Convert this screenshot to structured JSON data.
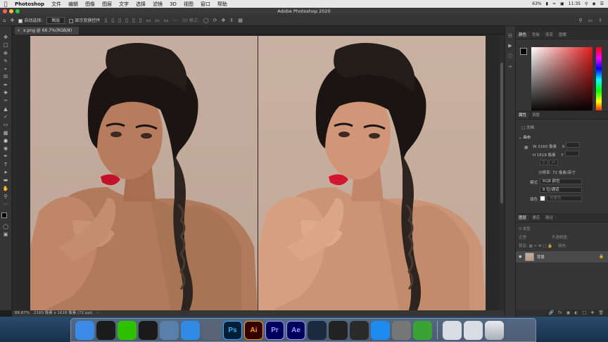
{
  "menubar": {
    "app": "Photoshop",
    "items": [
      "文件",
      "编辑",
      "图像",
      "图层",
      "文字",
      "选择",
      "滤镜",
      "3D",
      "视图",
      "窗口",
      "帮助"
    ],
    "battery": "63%",
    "clock": "11:35"
  },
  "window": {
    "title": "Adobe Photoshop 2020"
  },
  "options": {
    "auto_select_label": "自动选择:",
    "auto_select_value": "图层",
    "show_transform_label": "显示变换控件",
    "mode_3d_label": "3D 模式:"
  },
  "document": {
    "tab_label": "x.png @ 66.7%(RGB/8)",
    "zoom": "66.67%",
    "size_info": "2160 像素 x 1618 像素 (72 ppi)"
  },
  "color_panel": {
    "tabs": [
      "颜色",
      "色板",
      "渐变",
      "图案"
    ]
  },
  "properties_panel": {
    "tabs": [
      "属性",
      "调整"
    ],
    "doc_label": "文档",
    "canvas_section": "画布",
    "w_label": "W",
    "w_value": "2160 像素",
    "h_label": "H",
    "h_value": "1618 像素",
    "x_label": "X",
    "y_label": "Y",
    "resolution": "分辨率: 72 像素/英寸",
    "mode_label": "模式",
    "mode_value": "RGB 颜色",
    "depth_value": "8 位/通道",
    "fill_label": "填色",
    "fill_value": "背景色"
  },
  "layers_panel": {
    "tabs": [
      "图层",
      "通道",
      "路径"
    ],
    "kind_label": "类型",
    "blend_mode": "正常",
    "opacity_label": "不透明度:",
    "lock_label": "锁定:",
    "fill_label": "填充:",
    "layer_name": "背景"
  },
  "dock": {
    "apps": [
      {
        "name": "finder",
        "label": "",
        "color": "#3b8ce8"
      },
      {
        "name": "qq",
        "label": "",
        "color": "#1b1b1b"
      },
      {
        "name": "wechat",
        "label": "",
        "color": "#2dc100"
      },
      {
        "name": "music",
        "label": "",
        "color": "#1a1a1a"
      },
      {
        "name": "preview",
        "label": "",
        "color": "#5a7fa8"
      },
      {
        "name": "safari",
        "label": "",
        "color": "#2f8be3"
      },
      {
        "name": "launchpad",
        "label": "",
        "color": "#596574"
      },
      {
        "name": "photoshop",
        "label": "Ps",
        "color": "#001e36",
        "fg": "#31a8ff"
      },
      {
        "name": "illustrator",
        "label": "Ai",
        "color": "#330000",
        "fg": "#ff9a00"
      },
      {
        "name": "premiere",
        "label": "Pr",
        "color": "#00005b",
        "fg": "#9999ff"
      },
      {
        "name": "aftereffects",
        "label": "Ae",
        "color": "#00005b",
        "fg": "#9999ff"
      },
      {
        "name": "cinema4d",
        "label": "",
        "color": "#1c2a40"
      },
      {
        "name": "finalcut",
        "label": "",
        "color": "#222"
      },
      {
        "name": "davinci",
        "label": "",
        "color": "#2a2a2a"
      },
      {
        "name": "appstore",
        "label": "",
        "color": "#1e8bf0"
      },
      {
        "name": "settings",
        "label": "",
        "color": "#777"
      },
      {
        "name": "camtasia",
        "label": "",
        "color": "#3aa335"
      }
    ],
    "trash": ""
  }
}
